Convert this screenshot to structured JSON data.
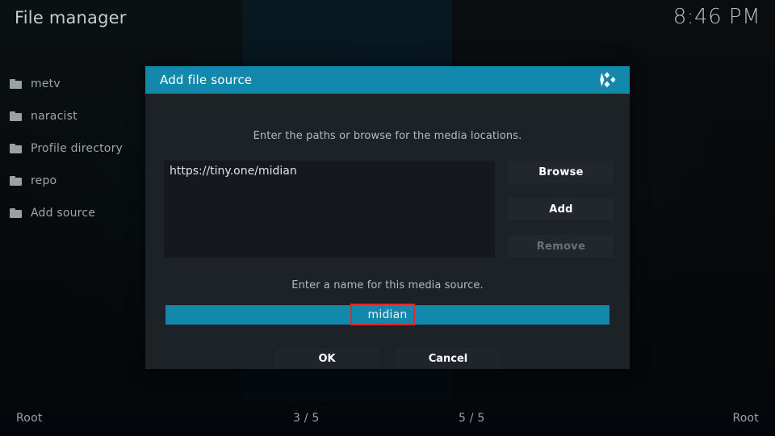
{
  "window": {
    "title": "File manager",
    "clock": "8:46 PM"
  },
  "theme": {
    "accent": "#1289ac",
    "dialog_bg": "#1d2227",
    "annotation": "#e02828",
    "text": "#dfe2e4"
  },
  "sidebar": {
    "items": [
      {
        "icon": "folder-icon",
        "label": "metv"
      },
      {
        "icon": "folder-icon",
        "label": "naracist"
      },
      {
        "icon": "folder-icon",
        "label": "Profile directory"
      },
      {
        "icon": "folder-icon",
        "label": "repo"
      },
      {
        "icon": "folder-icon",
        "label": "Add source"
      }
    ]
  },
  "dialog": {
    "title": "Add file source",
    "logo": "kodi-logo",
    "paths_hint": "Enter the paths or browse for the media locations.",
    "paths": [
      {
        "value": "https://tiny.one/midian"
      }
    ],
    "buttons": {
      "browse": "Browse",
      "add": "Add",
      "remove": "Remove"
    },
    "name_hint": "Enter a name for this media source.",
    "name_value": "midian",
    "ok": "OK",
    "cancel": "Cancel"
  },
  "footer": {
    "left": "Root",
    "count_left": "3 / 5",
    "count_right": "5 / 5",
    "right": "Root"
  }
}
